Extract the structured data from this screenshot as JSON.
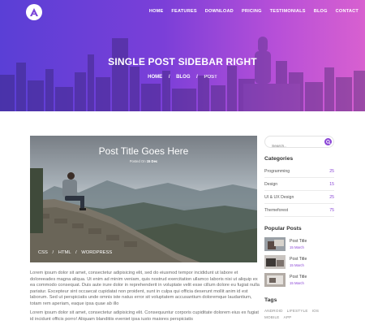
{
  "header": {
    "logo_icon": "a-logo-icon",
    "nav": [
      "HOME",
      "FEATURES",
      "DOWNLOAD",
      "PRICING",
      "TESTIMONIALS",
      "BLOG",
      "CONTACT"
    ]
  },
  "hero": {
    "title": "SINGLE POST SIDEBAR RIGHT",
    "breadcrumb": {
      "home": "HOME",
      "sep1": "/",
      "blog": "BLOG",
      "sep2": "/",
      "current": "POST"
    }
  },
  "post": {
    "title": "Post Title Goes Here",
    "meta_prefix": "Posted On",
    "meta_date": "15 Dec",
    "tags": {
      "t1": "CSS",
      "sep1": "/",
      "t2": "HTML",
      "sep2": "/",
      "t3": "WORDPRESS"
    },
    "paragraph1": "Lorem ipsum dolor sit amet, consectetur adipisicing elit, sed do eiusmod tempor incididunt ut labore et doloreeades magna aliqua. Ut enim ad minim veniam, quis nostrud exercitation ullamco laboris nisi ut aliquip ex ea commodo consequat. Duis aute irure dolor in reprehenderit in voluptate velit esse cillum dolore eu fugiat nulla pariatur. Excepteur sint occaecat cupidatat non proident, sunt in culpa qui officia deserunt mollit anim id est laborum. Sed ut perspiciatis unde omnis iste natus error sit voluptatem accusantium doloremque laudantium, totam rem aperiam, eaque ipsa quae ab illo",
    "paragraph2": "Lorem ipsum dolor sit amet, consectetur adipisicing elit. Consequuntur corporis cupiditate dolorem eius ex fugiat id incidunt officis porro! Aliquam blanditiis eveniet ipsa iusto maiores perspiciatis"
  },
  "sidebar": {
    "search_placeholder": "Search..",
    "categories_title": "Categories",
    "categories": [
      {
        "label": "Programming",
        "count": "25"
      },
      {
        "label": "Design",
        "count": "15"
      },
      {
        "label": "UI & UX Design",
        "count": "25"
      },
      {
        "label": "Themeforest",
        "count": "75"
      }
    ],
    "popular_title": "Popular Posts",
    "popular": [
      {
        "title": "Post Title",
        "date": "15 March"
      },
      {
        "title": "Post Title",
        "date": "15 March"
      },
      {
        "title": "Post Title",
        "date": "15 March"
      }
    ],
    "tags_title": "Tags",
    "tags": [
      "ANDROID",
      "LIFESTYLE",
      "IOS",
      "MOBILE",
      "APP"
    ]
  },
  "colors": {
    "accent": "#8a45d6",
    "gradient_start": "#5a3fd6",
    "gradient_end": "#d860d0"
  }
}
